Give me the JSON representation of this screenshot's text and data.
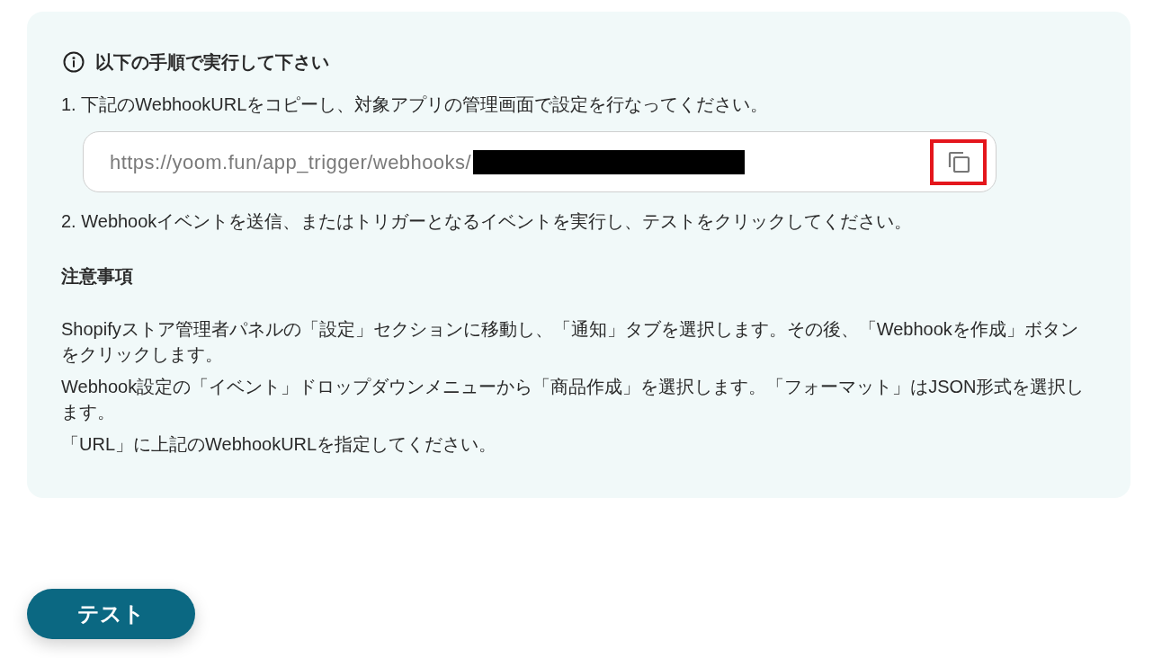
{
  "instructions": {
    "title": "以下の手順で実行して下さい",
    "items": [
      {
        "kind": "step",
        "text": "1. 下記のWebhookURLをコピーし、対象アプリの管理画面で設定を行なってください。"
      },
      {
        "kind": "url_field",
        "value": "https://yoom.fun/app_trigger/webhooks/",
        "redacted": true,
        "copy_highlighted": true
      },
      {
        "kind": "step",
        "text": "2. Webhookイベントを送信、またはトリガーとなるイベントを実行し、テストをクリックしてください。"
      }
    ],
    "notes": {
      "title": "注意事項",
      "paragraphs": [
        "Shopifyストア管理者パネルの「設定」セクションに移動し、「通知」タブを選択します。その後、「Webhookを作成」ボタンをクリックします。",
        "Webhook設定の「イベント」ドロップダウンメニューから「商品作成」を選択します。「フォーマット」はJSON形式を選択します。",
        "「URL」に上記のWebhookURLを指定してください。"
      ]
    }
  },
  "test_button": {
    "label": "テスト"
  }
}
